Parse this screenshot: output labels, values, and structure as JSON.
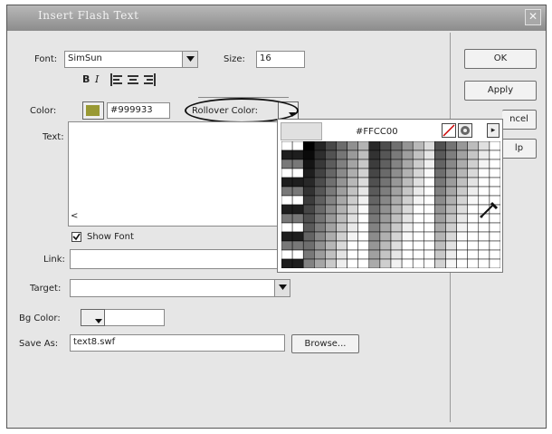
{
  "dialog": {
    "title": "Insert Flash Text",
    "close_glyph": "✕"
  },
  "form": {
    "font_label": "Font:",
    "font_value": "SimSun",
    "size_label": "Size:",
    "size_value": "16",
    "bold_glyph": "B",
    "italic_glyph": "I",
    "color_label": "Color:",
    "color_value": "#999933",
    "rollover_label": "Rollover Color:",
    "text_label": "Text:",
    "scroll_left_glyph": "<",
    "show_font_label": "Show Font",
    "show_font_checked": true,
    "link_label": "Link:",
    "target_label": "Target:",
    "bg_color_label": "Bg Color:",
    "save_as_label": "Save As:",
    "save_as_value": "text8.swf",
    "browse_label": "Browse..."
  },
  "buttons": {
    "ok": "OK",
    "apply": "Apply",
    "cancel": "ncel",
    "help": "lp"
  },
  "palette": {
    "hex_value": "#FFCC00",
    "menu_arrow": "▸"
  },
  "colors": {
    "titlebar": "#9a9a9a",
    "dialog_bg": "#e6e6e6",
    "color_swatch": "#999933"
  },
  "icons": {
    "align_left": "align-left-icon",
    "align_center": "align-center-icon",
    "align_right": "align-right-icon",
    "dropdown": "chevron-down-icon",
    "no_color": "no-color-icon",
    "system_color": "color-wheel-icon",
    "eyedropper": "eyedropper-icon"
  }
}
